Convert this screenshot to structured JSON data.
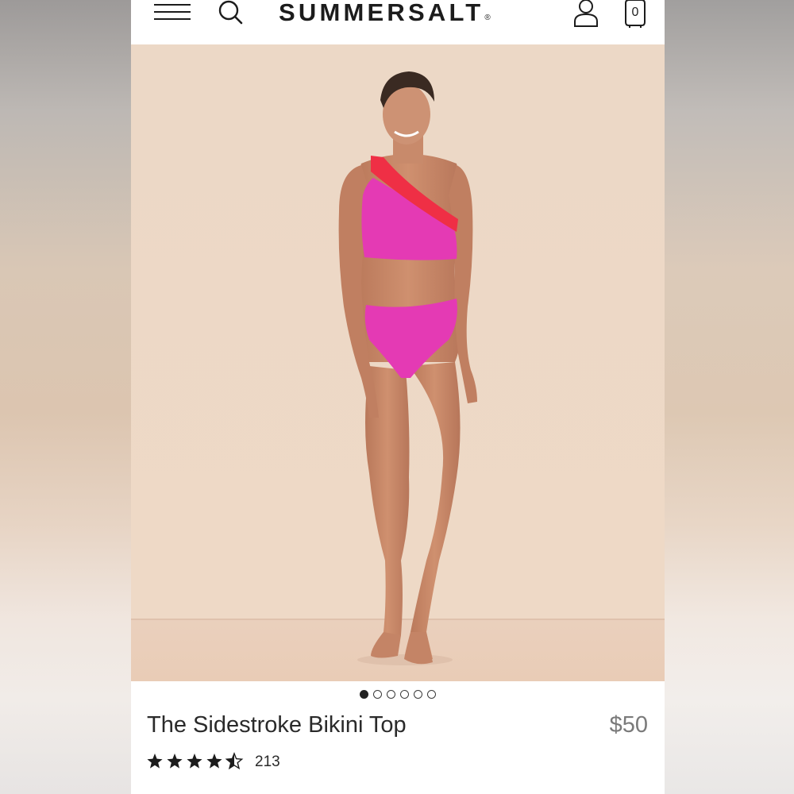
{
  "header": {
    "brand": "SUMMERSALT",
    "brand_mark": "®",
    "cart_count": "0",
    "icons": [
      "menu-icon",
      "search-icon",
      "account-icon",
      "cart-icon"
    ]
  },
  "hero": {
    "image": "model wearing pink one-shoulder bikini with red strap",
    "carousel_total": 6,
    "carousel_active": 1
  },
  "product": {
    "title": "The Sidestroke Bikini Top",
    "price": "$50",
    "rating": 4.5,
    "rating_max": 5,
    "review_count": "213"
  },
  "colors": {
    "swim_pink": "#e43ab4",
    "swim_red": "#ef2f45",
    "backdrop": "#efdcca",
    "text": "#2a2a2a",
    "price_text": "#7a7a7a"
  }
}
